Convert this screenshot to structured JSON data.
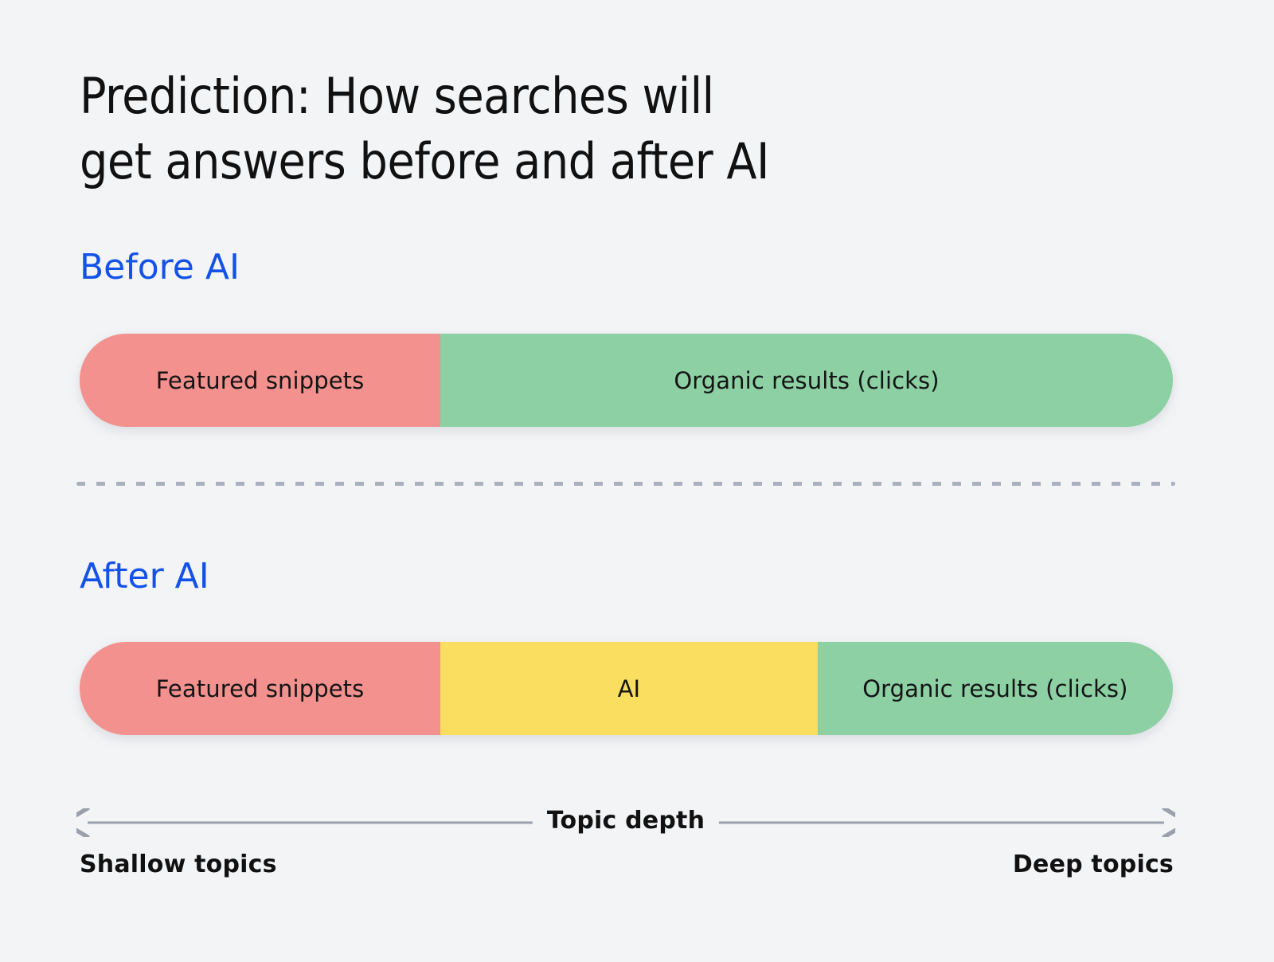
{
  "background_color": "#f3f4f6",
  "title": "Prediction: How searches will\nget answers before and after AI",
  "sections": [
    {
      "heading": "Before AI",
      "heading_color": "#1352e8",
      "segments": [
        {
          "label": "Featured snippets",
          "color": "#f2918e",
          "width_pct": 33
        },
        {
          "label": "Organic results (clicks)",
          "color": "#8cd0a4",
          "width_pct": 67
        }
      ]
    },
    {
      "heading": "After AI",
      "heading_color": "#1352e8",
      "segments": [
        {
          "label": "Featured snippets",
          "color": "#f2918e",
          "width_pct": 33
        },
        {
          "label": "AI",
          "color": "#fade60",
          "width_pct": 34.5
        },
        {
          "label": "Organic results (clicks)",
          "color": "#8cd0a4",
          "width_pct": 32.5
        }
      ]
    }
  ],
  "divider": {
    "style": "dashed",
    "color": "#aab0bd"
  },
  "axis": {
    "label": "Topic depth",
    "left_endpoint": "Shallow topics",
    "right_endpoint": "Deep topics",
    "line_color": "#9aa0ac",
    "arrows": "both"
  },
  "chart_data": {
    "type": "bar",
    "title": "Prediction: How searches will get answers before and after AI",
    "orientation": "horizontal-stacked",
    "xlabel": "Topic depth",
    "ylabel": "",
    "x_axis_range_labels": [
      "Shallow topics",
      "Deep topics"
    ],
    "categories": [
      "Before AI",
      "After AI"
    ],
    "series": [
      {
        "name": "Featured snippets",
        "values": [
          33,
          33
        ],
        "color": "#f2918e"
      },
      {
        "name": "AI",
        "values": [
          0,
          34.5
        ],
        "color": "#fade60"
      },
      {
        "name": "Organic results (clicks)",
        "values": [
          67,
          32.5
        ],
        "color": "#8cd0a4"
      }
    ],
    "units": "percent of topic-depth span",
    "grid": false,
    "legend": "none (in-bar labels)"
  }
}
